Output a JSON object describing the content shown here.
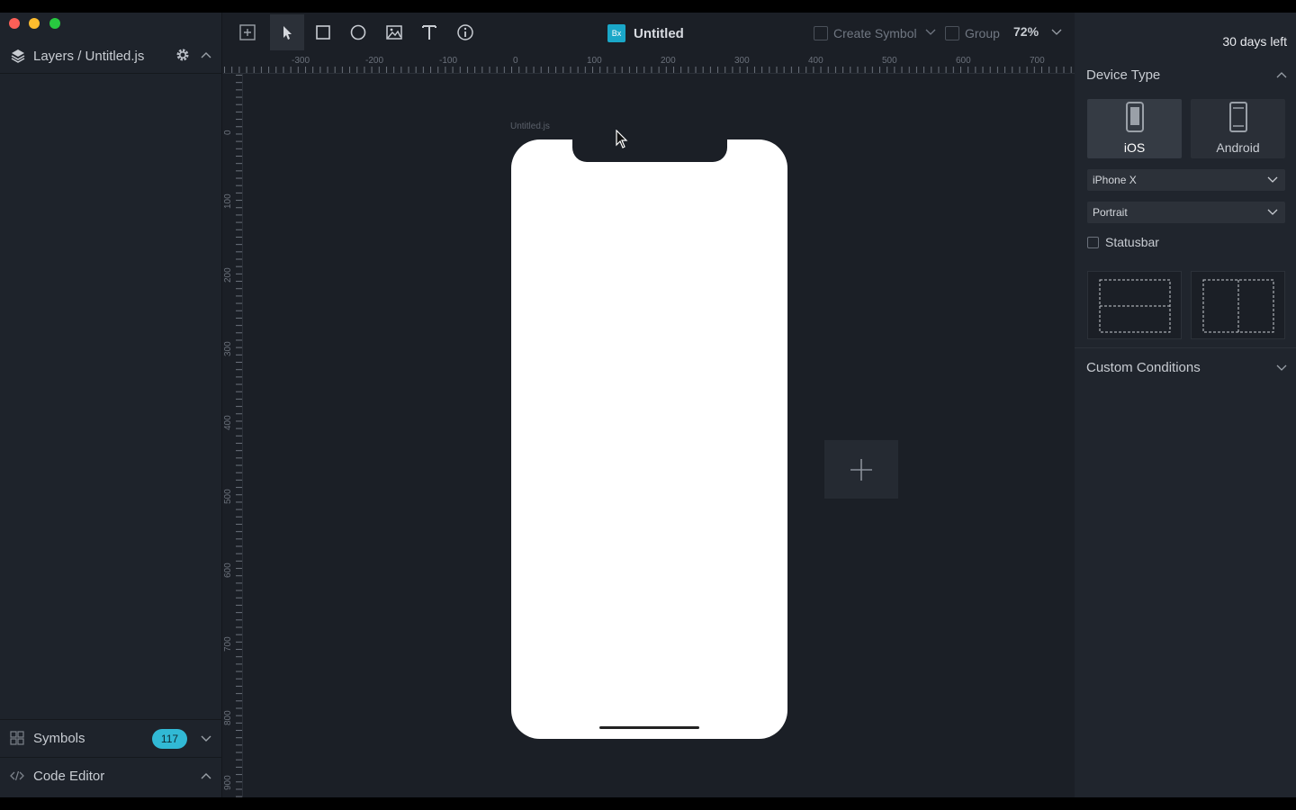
{
  "window": {
    "controls": [
      "close",
      "minimize",
      "maximize"
    ]
  },
  "sidebar": {
    "layers_title": "Layers / Untitled.js",
    "symbols_label": "Symbols",
    "symbols_count": "117",
    "code_editor_label": "Code Editor"
  },
  "toolbar": {
    "tools": [
      "insert-frame",
      "select",
      "rectangle",
      "oval",
      "image",
      "text",
      "info"
    ],
    "active_tool": "select",
    "doc_icon_text": "Bx",
    "doc_title": "Untitled",
    "create_symbol_label": "Create Symbol",
    "group_label": "Group",
    "zoom": "72%"
  },
  "rulers": {
    "top_labels": [
      "-300",
      "-200",
      "-100",
      "0",
      "100",
      "200",
      "300",
      "400",
      "500",
      "600",
      "700"
    ],
    "left_labels": [
      "0",
      "100",
      "200",
      "300",
      "400",
      "500",
      "600",
      "700",
      "800",
      "900"
    ]
  },
  "canvas": {
    "frame_label": "Untitled.js"
  },
  "panel": {
    "trial_text": "30 days left",
    "device_type_title": "Device Type",
    "devices": [
      {
        "label": "iOS",
        "selected": true
      },
      {
        "label": "Android",
        "selected": false
      }
    ],
    "model_select": "iPhone X",
    "orientation_select": "Portrait",
    "statusbar_label": "Statusbar",
    "statusbar_checked": false,
    "custom_conditions_title": "Custom Conditions"
  },
  "colors": {
    "accent": "#31b9d5",
    "background": "#1b1f26",
    "panel": "#20252d"
  }
}
